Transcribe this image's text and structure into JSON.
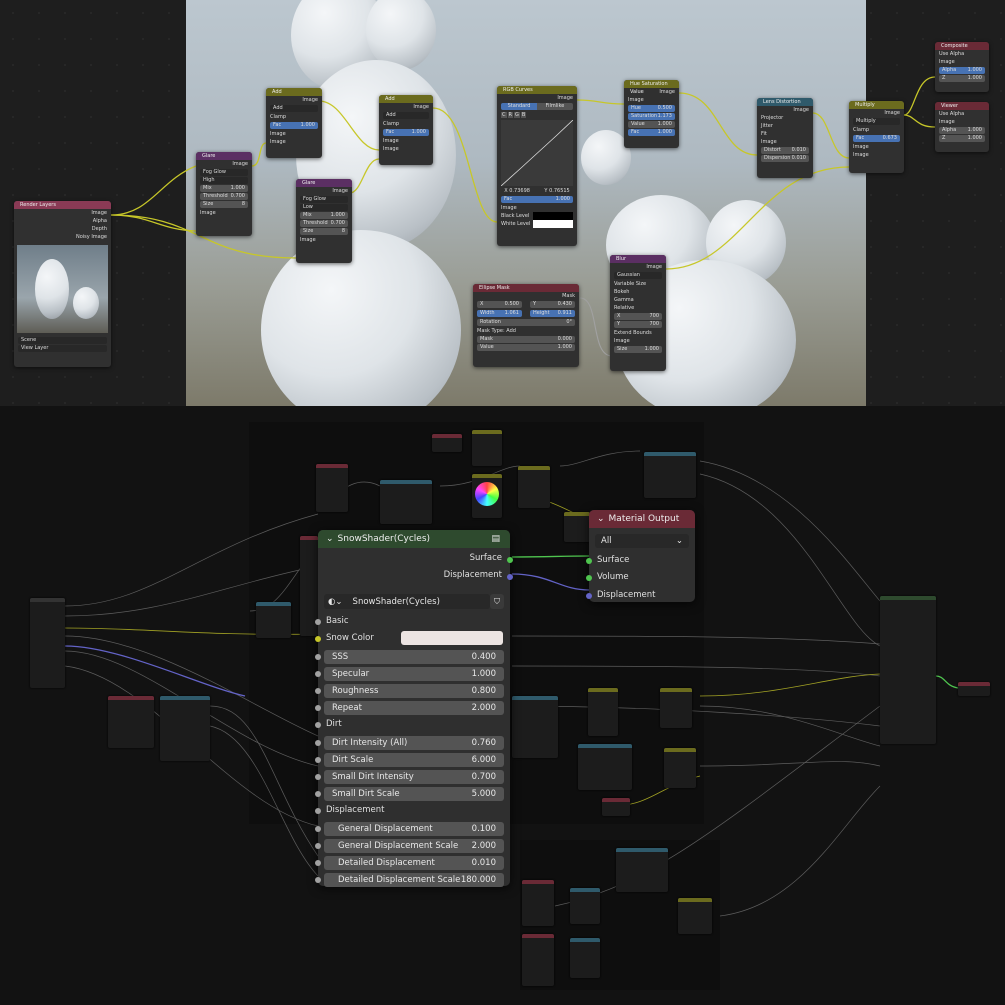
{
  "compositor": {
    "render_layers": {
      "title": "Render Layers",
      "outputs": [
        "Image",
        "Alpha",
        "Depth",
        "Noisy Image"
      ],
      "scene": "Scene",
      "view_layer": "View Layer"
    },
    "glare1": {
      "title": "Glare",
      "output": "Image",
      "type": "Fog Glow",
      "quality": "High",
      "mix_label": "Mix",
      "mix": "1.000",
      "threshold_label": "Threshold",
      "threshold": "0.700",
      "size_label": "Size",
      "size": "8",
      "input": "Image"
    },
    "add1": {
      "title": "Add",
      "output": "Image",
      "mode": "Add",
      "clamp": "Clamp",
      "fac_label": "Fac",
      "fac": "1.000",
      "in1": "Image",
      "in2": "Image"
    },
    "glare2": {
      "title": "Glare",
      "output": "Image",
      "type": "Fog Glow",
      "quality": "Low",
      "mix_label": "Mix",
      "mix": "1.000",
      "threshold_label": "Threshold",
      "threshold": "0.700",
      "size_label": "Size",
      "size": "8",
      "input": "Image"
    },
    "add2": {
      "title": "Add",
      "output": "Image",
      "mode": "Add",
      "clamp": "Clamp",
      "fac_label": "Fac",
      "fac": "1.000",
      "in1": "Image",
      "in2": "Image"
    },
    "rgb_curves": {
      "title": "RGB Curves",
      "output": "Image",
      "tab_standard": "Standard",
      "tab_filmlike": "Filmlike",
      "channels": [
        "C",
        "R",
        "G",
        "B"
      ],
      "x": "X 0.73698",
      "y": "Y 0.76515",
      "fac_label": "Fac",
      "fac": "1.000",
      "image": "Image",
      "black": "Black Level",
      "white": "White Level"
    },
    "hsv": {
      "title": "Hue Saturation Value",
      "output": "Image",
      "input": "Image",
      "hue_label": "Hue",
      "hue": "0.500",
      "sat_label": "Saturation",
      "sat": "1.173",
      "val_label": "Value",
      "val": "1.000",
      "fac_label": "Fac",
      "fac": "1.000"
    },
    "ellipse": {
      "title": "Ellipse Mask",
      "output": "Mask",
      "x_label": "X",
      "x": "0.500",
      "y_label": "Y",
      "y": "0.430",
      "w_label": "Width",
      "w": "1.061",
      "h_label": "Height",
      "h": "0.911",
      "rot_label": "Rotation",
      "rot": "0°",
      "mask_type_label": "Mask Type:",
      "mask_type": "Add",
      "mask_label": "Mask",
      "mask": "0.000",
      "value_label": "Value",
      "value": "1.000"
    },
    "blur": {
      "title": "Blur",
      "output": "Image",
      "type": "Gaussian",
      "opts": [
        "Variable Size",
        "Bokeh",
        "Gamma",
        "Relative"
      ],
      "x_label": "X",
      "x": "700",
      "y_label": "Y",
      "y": "700",
      "extend": "Extend Bounds",
      "input": "Image",
      "size_label": "Size",
      "size": "1.000"
    },
    "lens": {
      "title": "Lens Distortion",
      "output": "Image",
      "opts": [
        "Projector",
        "Jitter",
        "Fit"
      ],
      "input": "Image",
      "distort_label": "Distort",
      "distort": "0.010",
      "disp_label": "Dispersion",
      "disp": "0.010"
    },
    "multiply": {
      "title": "Multiply",
      "output": "Image",
      "mode": "Multiply",
      "clamp": "Clamp",
      "fac_label": "Fac",
      "fac": "0.673",
      "in1": "Image",
      "in2": "Image"
    },
    "composite": {
      "title": "Composite",
      "use_alpha": "Use Alpha",
      "image": "Image",
      "alpha_label": "Alpha",
      "alpha": "1.000",
      "z_label": "Z",
      "z": "1.000"
    },
    "viewer": {
      "title": "Viewer",
      "use_alpha": "Use Alpha",
      "image": "Image",
      "alpha_label": "Alpha",
      "alpha": "1.000",
      "z_label": "Z",
      "z": "1.000"
    }
  },
  "shader": {
    "title": "SnowShader(Cycles)",
    "outputs": {
      "surface": "Surface",
      "displacement": "Displacement"
    },
    "group_name": "SnowShader(Cycles)",
    "sections": {
      "basic": "Basic",
      "dirt": "Dirt",
      "displacement": "Displacement"
    },
    "snow_color_label": "Snow Color",
    "snow_color": "#ece4e2",
    "fields": [
      {
        "label": "SSS",
        "value": "0.400"
      },
      {
        "label": "Specular",
        "value": "1.000"
      },
      {
        "label": "Roughness",
        "value": "0.800"
      },
      {
        "label": "Repeat",
        "value": "2.000"
      },
      {
        "label": "Dirt Intensity (All)",
        "value": "0.760"
      },
      {
        "label": "Dirt Scale",
        "value": "6.000"
      },
      {
        "label": "Small Dirt Intensity",
        "value": "0.700"
      },
      {
        "label": "Small Dirt Scale",
        "value": "5.000"
      },
      {
        "label": "General Displacement",
        "value": "0.100"
      },
      {
        "label": "General Displacement Scale",
        "value": "2.000"
      },
      {
        "label": "Detailed Displacement",
        "value": "0.010"
      },
      {
        "label": "Detailed Displacement Scale",
        "value": "180.000"
      }
    ]
  },
  "material_output": {
    "title": "Material Output",
    "target": "All",
    "inputs": [
      "Surface",
      "Volume",
      "Displacement"
    ]
  },
  "colors": {
    "input_header": "#8a3a55",
    "filter_header": "#5b2f63",
    "color_header": "#6b6b1e",
    "converter_header": "#2f5a6b",
    "group_header": "#2e4a2e",
    "output_header": "#6a2a36",
    "image_socket": "#c7c729",
    "float_socket": "#a1a1a1",
    "shader_socket": "#4fc54f",
    "vector_socket": "#6363c7",
    "selected_field": "#4772b3"
  }
}
